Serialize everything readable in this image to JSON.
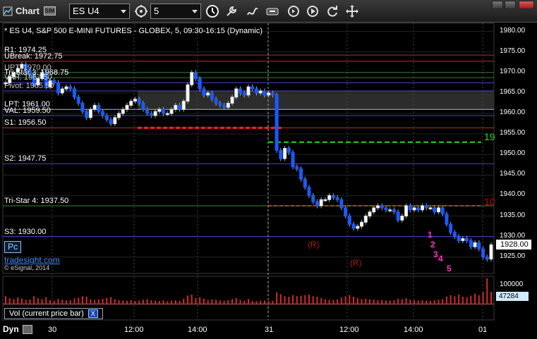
{
  "window": {
    "title": "Chart",
    "sim_badge": "SIM",
    "symbol": "ES U4",
    "interval": "5",
    "colors": {
      "toolbar": "#2a2a2a",
      "background": "#000000"
    }
  },
  "toolbar_icons": [
    "history-icon",
    "clock-icon",
    "wrench-icon",
    "draw-icon",
    "link-icon",
    "goto-icon",
    "play-icon",
    "refresh-icon",
    "move-icon"
  ],
  "chart": {
    "header": "* ES U4, S&P 500 E-MINI FUTURES - GLOBEX, 5, 09:30-16:15 (Dynamic)",
    "pc_button": "Pc",
    "brand_link": "tradesight.com",
    "copyright": "© eSignal, 2014",
    "volume_panel_label": "Vol (current price bar)",
    "dyn_label": "Dyn",
    "left_levels": [
      {
        "text": "R1: 1974.25",
        "y": 1974.25
      },
      {
        "text": "UBreak: 1972.75",
        "y": 1972.75
      },
      {
        "text": "Tri-Star 3: 1968.75",
        "y": 1968.75
      },
      {
        "text": "LPT: 1961.00",
        "y": 1961.0
      },
      {
        "text": "VAL: 1959.50",
        "y": 1959.5
      },
      {
        "text": "S1: 1956.50",
        "y": 1956.5
      },
      {
        "text": "S2: 1947.75",
        "y": 1947.75
      },
      {
        "text": "Tri-Star 4: 1937.50",
        "y": 1937.5
      },
      {
        "text": "S3: 1930.00",
        "y": 1930.0
      }
    ],
    "overlap_labels": [
      {
        "text": "UPT: 1970.00",
        "y": 1970.0
      },
      {
        "text": "VAH: 1967.50",
        "y": 1967.5
      },
      {
        "text": "Pivot: 1965.50",
        "y": 1965.5
      }
    ],
    "annotations": [
      {
        "text": "19",
        "color": "#22dd22"
      },
      {
        "text": "10",
        "color": "#d00000"
      },
      {
        "text": "(R)",
        "color": "#b01818"
      },
      {
        "text": "(R)",
        "color": "#b01818"
      },
      {
        "text": "1",
        "color": "#ff33cc"
      },
      {
        "text": "2",
        "color": "#ff33cc"
      },
      {
        "text": "3",
        "color": "#ff33cc"
      },
      {
        "text": "4",
        "color": "#ff33cc"
      },
      {
        "text": "5",
        "color": "#ff33cc"
      }
    ],
    "price_axis": [
      "1980.00",
      "1975.00",
      "1970.00",
      "1965.00",
      "1960.00",
      "1955.00",
      "1950.00",
      "1945.00",
      "1940.00",
      "1935.00",
      "1930.00",
      "1925.00"
    ],
    "current_price": "1928.00",
    "volume_axis": [
      "100000"
    ],
    "current_volume": "47284",
    "time_axis": [
      "30",
      "12:00",
      "14:00",
      "31",
      "12:00",
      "14:00",
      "01"
    ]
  },
  "chart_data": {
    "type": "candlestick",
    "ylim": [
      1921,
      1982
    ],
    "grid": true,
    "levels": [
      1974.25,
      1972.75,
      1970.0,
      1968.75,
      1967.5,
      1965.5,
      1961.0,
      1959.5,
      1956.5,
      1947.75,
      1937.5,
      1930.0
    ],
    "close": [
      1967.5,
      1969.0,
      1970.0,
      1971.0,
      1972.0,
      1970.5,
      1969.5,
      1967.0,
      1968.5,
      1970.0,
      1966.5,
      1968.0,
      1967.5,
      1965.0,
      1966.0,
      1966.5,
      1966.0,
      1964.0,
      1962.5,
      1960.5,
      1959.0,
      1961.0,
      1962.0,
      1960.5,
      1959.5,
      1958.5,
      1957.5,
      1959.0,
      1960.0,
      1961.0,
      1962.0,
      1963.0,
      1963.5,
      1962.5,
      1961.0,
      1960.0,
      1959.5,
      1960.5,
      1961.0,
      1960.0,
      1960.0,
      1961.0,
      1962.0,
      1961.0,
      1963.0,
      1967.0,
      1970.0,
      1968.5,
      1966.0,
      1964.5,
      1965.0,
      1963.5,
      1962.5,
      1962.0,
      1961.5,
      1962.5,
      1964.0,
      1966.0,
      1965.0,
      1964.5,
      1966.5,
      1966.0,
      1965.0,
      1965.5,
      1964.5,
      1965.0,
      1964.5,
      1951.0,
      1949.0,
      1951.5,
      1950.5,
      1947.0,
      1946.5,
      1944.0,
      1942.0,
      1940.0,
      1938.5,
      1937.5,
      1939.0,
      1939.0,
      1940.0,
      1939.5,
      1939.0,
      1937.0,
      1935.0,
      1933.0,
      1932.0,
      1932.5,
      1933.5,
      1935.0,
      1936.0,
      1937.0,
      1937.5,
      1937.0,
      1936.5,
      1936.5,
      1936.0,
      1934.0,
      1935.0,
      1937.5,
      1936.5,
      1937.0,
      1936.5,
      1937.5,
      1937.0,
      1937.0,
      1936.0,
      1937.0,
      1935.5,
      1933.0,
      1931.0,
      1930.0,
      1929.0,
      1929.5,
      1929.0,
      1927.5,
      1928.5,
      1927.0,
      1925.0,
      1924.5,
      1928.0
    ],
    "volume": [
      30000,
      22000,
      18000,
      25000,
      20000,
      15000,
      17000,
      30000,
      22000,
      18000,
      26000,
      14000,
      12000,
      19000,
      16000,
      13000,
      14000,
      21000,
      24000,
      30000,
      28000,
      18000,
      15000,
      17000,
      20000,
      23000,
      26000,
      18000,
      14000,
      13000,
      12000,
      15000,
      11000,
      12000,
      16000,
      18000,
      14000,
      12000,
      11000,
      13000,
      10000,
      12000,
      14000,
      11000,
      20000,
      32000,
      36000,
      22000,
      26000,
      20000,
      15000,
      17000,
      16000,
      13000,
      12000,
      14000,
      18000,
      22000,
      15000,
      12000,
      19000,
      11000,
      10000,
      12000,
      13000,
      11000,
      12000,
      45000,
      38000,
      30000,
      28000,
      34000,
      30000,
      32000,
      34000,
      36000,
      30000,
      28000,
      22000,
      18000,
      16000,
      15000,
      17000,
      24000,
      30000,
      34000,
      28000,
      22000,
      18000,
      20000,
      17000,
      16000,
      14000,
      15000,
      13000,
      12000,
      14000,
      20000,
      18000,
      22000,
      16000,
      14000,
      13000,
      15000,
      12000,
      11000,
      14000,
      16000,
      18000,
      28000,
      34000,
      30000,
      36000,
      28000,
      26000,
      32000,
      40000,
      34000,
      46000,
      100000,
      47284
    ]
  }
}
